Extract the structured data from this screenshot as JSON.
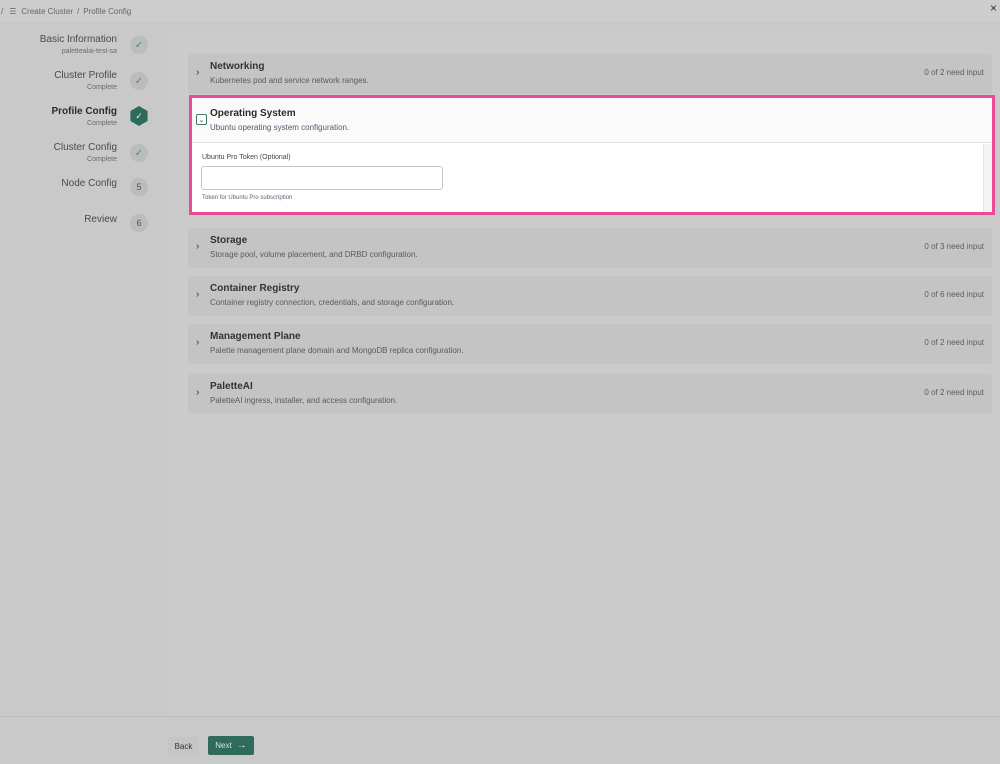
{
  "breadcrumb": {
    "lead": "/",
    "icon": "grid-icon",
    "items": [
      "Create Cluster",
      "Profile Config"
    ],
    "separator": "/"
  },
  "close_icon": "×",
  "steps": [
    {
      "name": "Basic Information",
      "sub": "palettealai-test-sa",
      "state": "done",
      "marker": "✓"
    },
    {
      "name": "Cluster Profile",
      "sub": "Complete",
      "state": "done",
      "marker": "✓"
    },
    {
      "name": "Profile Config",
      "sub": "Complete",
      "state": "active",
      "marker": "✓"
    },
    {
      "name": "Cluster Config",
      "sub": "Complete",
      "state": "done",
      "marker": "✓"
    },
    {
      "name": "Node Config",
      "sub": "",
      "state": "pending",
      "marker": "5"
    },
    {
      "name": "Review",
      "sub": "",
      "state": "pending",
      "marker": "6"
    }
  ],
  "sections": [
    {
      "title": "Networking",
      "desc": "Kubernetes pod and service network ranges.",
      "status": "0 of 2 need input"
    },
    {
      "title": "Storage",
      "desc": "Storage pool, volume placement, and DRBD configuration.",
      "status": "0 of 3 need input"
    },
    {
      "title": "Container Registry",
      "desc": "Container registry connection, credentials, and storage configuration.",
      "status": "0 of 6 need input"
    },
    {
      "title": "Management Plane",
      "desc": "Palette management plane domain and MongoDB replica configuration.",
      "status": "0 of 2 need input"
    },
    {
      "title": "PaletteAI",
      "desc": "PaletteAI ingress, installer, and access configuration.",
      "status": "0 of 2 need input"
    }
  ],
  "os_section": {
    "title": "Operating System",
    "desc": "Ubuntu operating system configuration.",
    "field_label": "Ubuntu Pro Token  (Optional)",
    "field_value": "",
    "field_placeholder": "",
    "field_help": "Token for Ubuntu Pro subscription"
  },
  "footer": {
    "back_label": "Back",
    "next_label": "Next",
    "next_arrow": "→"
  },
  "colors": {
    "accent": "#2f6b5a",
    "highlight": "#ea4b97",
    "done_check": "#3f8f6c"
  }
}
